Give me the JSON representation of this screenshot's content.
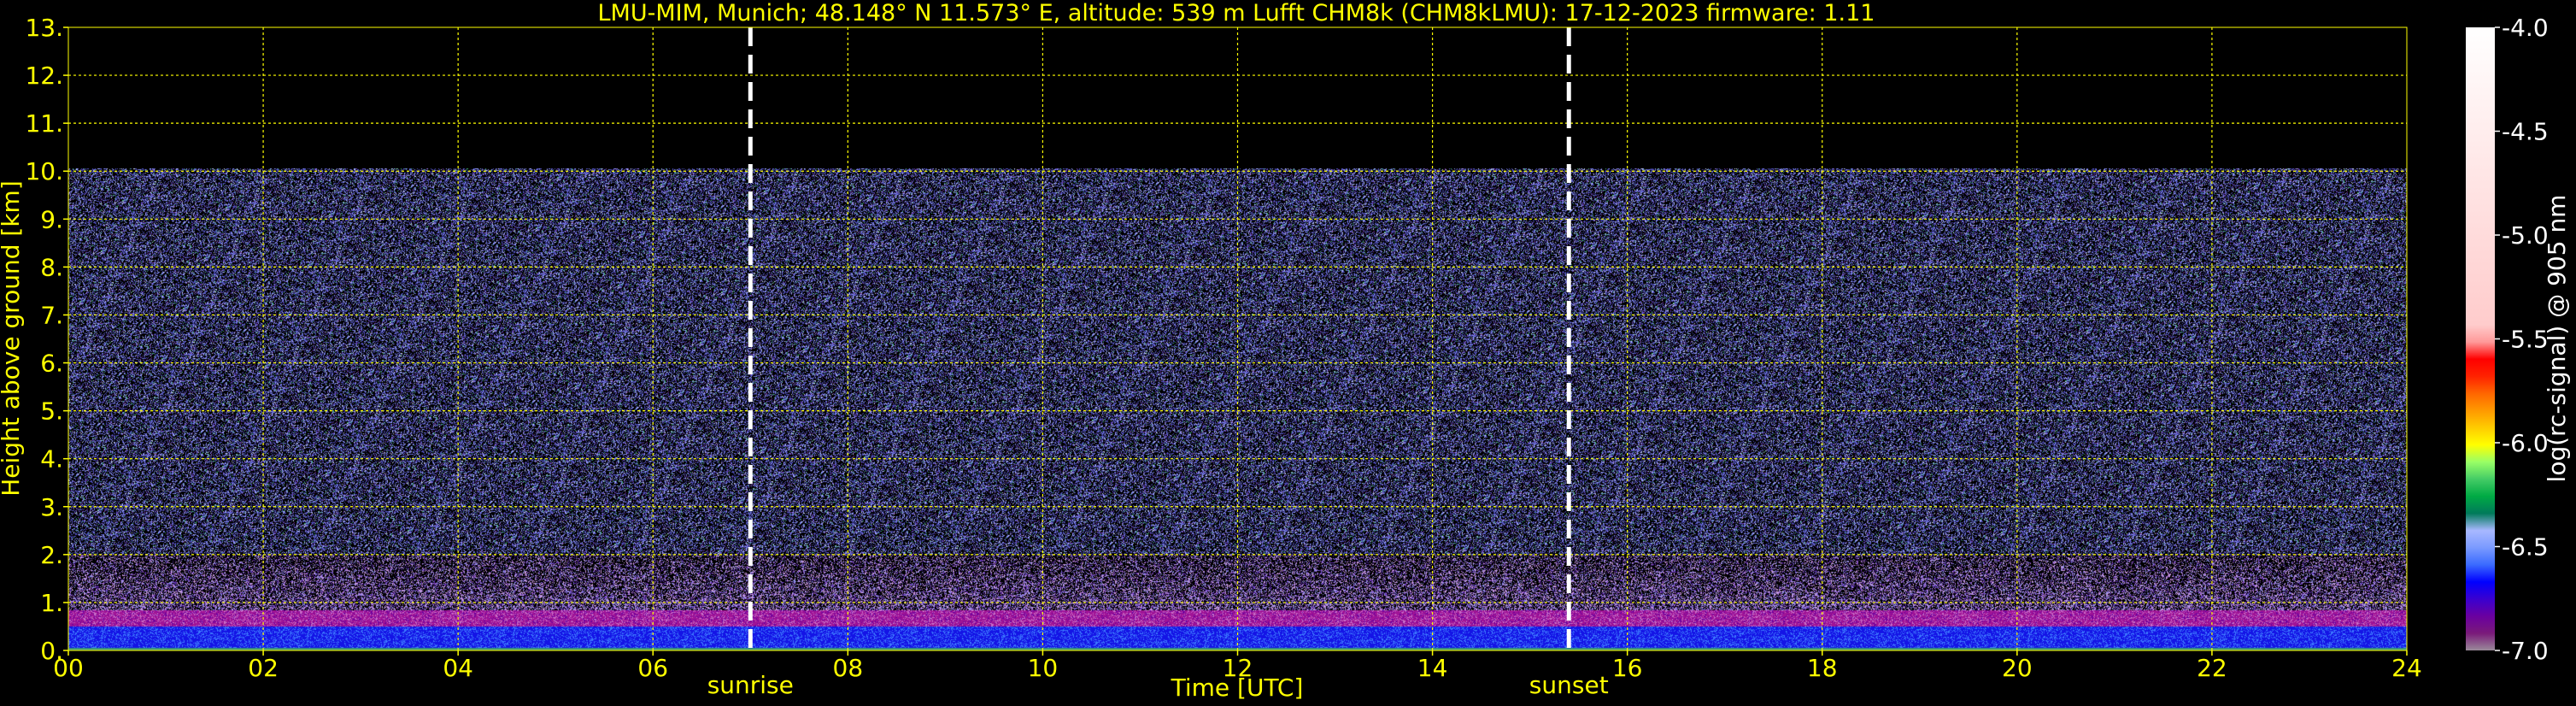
{
  "chart_data": {
    "type": "heatmap",
    "title": "LMU-MIM, Munich; 48.148° N 11.573° E, altitude: 539 m    Lufft CHM8k (CHM8kLMU): 17-12-2023    firmware: 1.11",
    "xlabel": "Time [UTC]",
    "ylabel": "Height above ground [km]",
    "xlim": [
      0,
      24
    ],
    "ylim": [
      0,
      13
    ],
    "x_ticks": [
      0,
      2,
      4,
      6,
      8,
      10,
      12,
      14,
      16,
      18,
      20,
      22,
      24
    ],
    "x_tick_labels": [
      "00",
      "02",
      "04",
      "06",
      "08",
      "10",
      "12",
      "14",
      "16",
      "18",
      "20",
      "22",
      "24"
    ],
    "y_ticks": [
      0,
      1,
      2,
      3,
      4,
      5,
      6,
      7,
      8,
      9,
      10,
      11,
      12,
      13
    ],
    "y_tick_labels": [
      "0.",
      "1.",
      "2.",
      "3.",
      "4.",
      "5.",
      "6.",
      "7.",
      "8.",
      "9.",
      "10.",
      "11.",
      "12.",
      "13."
    ],
    "grid": true,
    "grid_color": "#ffff00",
    "data_top_km": 10,
    "annotations": [
      {
        "label": "sunrise",
        "x": 7.0
      },
      {
        "label": "sunset",
        "x": 15.4
      }
    ],
    "colorbar": {
      "label": "log(rc-signal) @ 905 nm",
      "range": [
        -7.0,
        -4.0
      ],
      "ticks": [
        -7.0,
        -6.5,
        -6.0,
        -5.5,
        -5.0,
        -4.5,
        -4.0
      ],
      "tick_labels": [
        "-7.0",
        "-6.5",
        "-6.0",
        "-5.5",
        "-5.0",
        "-4.5",
        "-4.0"
      ]
    },
    "layers": [
      {
        "height_km": [
          0.0,
          0.05
        ],
        "description_color": "#44aa88"
      },
      {
        "height_km": [
          0.25,
          0.5
        ],
        "description_color": "#2222ee"
      },
      {
        "height_km": [
          0.5,
          0.8
        ],
        "description_color": "#aa1199"
      }
    ]
  },
  "colors": {
    "background": "#000000",
    "text": "#ffff00",
    "marker_line": "#ffffff",
    "colorbar_stops": [
      "#9a8a9a",
      "#7a1a7a",
      "#6a00a0",
      "#3a00d0",
      "#0000ff",
      "#3a6aff",
      "#7a9aff",
      "#a8b8ff",
      "#007a5a",
      "#00aa44",
      "#44cc66",
      "#99ff66",
      "#ffff00",
      "#ffcc00",
      "#ff9900",
      "#ff6600",
      "#ff2200",
      "#ff0000",
      "#ff9999",
      "#ffcccc",
      "#ffffff"
    ]
  }
}
